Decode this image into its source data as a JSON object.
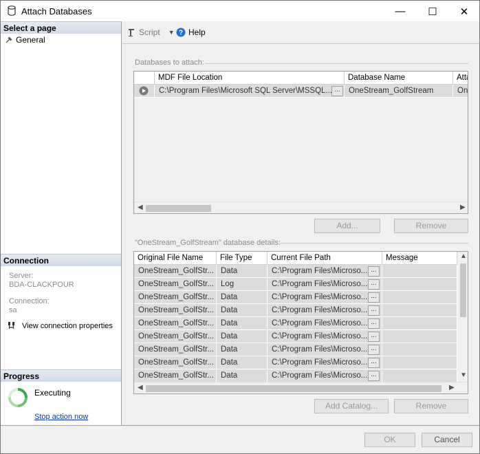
{
  "window": {
    "title": "Attach Databases",
    "minimize_glyph": "—",
    "maximize_glyph": "☐",
    "close_glyph": "✕"
  },
  "left": {
    "select_page_header": "Select a page",
    "general_label": "General",
    "connection_header": "Connection",
    "server_label": "Server:",
    "server_value": "BDA-CLACKPOUR",
    "connection_label": "Connection:",
    "connection_value": "sa",
    "view_props_label": "View connection properties",
    "progress_header": "Progress",
    "progress_status": "Executing",
    "stop_link": "Stop action now"
  },
  "toolbar": {
    "script_label": "Script",
    "help_label": "Help"
  },
  "attach": {
    "group_label": "Databases to attach:",
    "columns": [
      "MDF File Location",
      "Database Name",
      "Atta"
    ],
    "rows": [
      {
        "mdf": "C:\\Program Files\\Microsoft SQL Server\\MSSQL...",
        "dbname": "OneStream_GolfStream",
        "attach_as": "One"
      }
    ],
    "add_button": "Add...",
    "remove_button": "Remove"
  },
  "details": {
    "group_label": "\"OneStream_GolfStream\" database details:",
    "columns": [
      "Original File Name",
      "File Type",
      "Current File Path",
      "Message"
    ],
    "rows": [
      {
        "name": "OneStream_GolfStr...",
        "type": "Data",
        "path": "C:\\Program Files\\Microso...",
        "message": ""
      },
      {
        "name": "OneStream_GolfStr...",
        "type": "Log",
        "path": "C:\\Program Files\\Microso...",
        "message": ""
      },
      {
        "name": "OneStream_GolfStr...",
        "type": "Data",
        "path": "C:\\Program Files\\Microso...",
        "message": ""
      },
      {
        "name": "OneStream_GolfStr...",
        "type": "Data",
        "path": "C:\\Program Files\\Microso...",
        "message": ""
      },
      {
        "name": "OneStream_GolfStr...",
        "type": "Data",
        "path": "C:\\Program Files\\Microso...",
        "message": ""
      },
      {
        "name": "OneStream_GolfStr...",
        "type": "Data",
        "path": "C:\\Program Files\\Microso...",
        "message": ""
      },
      {
        "name": "OneStream_GolfStr...",
        "type": "Data",
        "path": "C:\\Program Files\\Microso...",
        "message": ""
      },
      {
        "name": "OneStream_GolfStr...",
        "type": "Data",
        "path": "C:\\Program Files\\Microso...",
        "message": ""
      },
      {
        "name": "OneStream_GolfStr...",
        "type": "Data",
        "path": "C:\\Program Files\\Microso...",
        "message": ""
      }
    ],
    "browse_glyph": "...",
    "add_catalog_button": "Add Catalog...",
    "remove_button": "Remove"
  },
  "footer": {
    "ok_button": "OK",
    "cancel_button": "Cancel"
  },
  "colors": {
    "section_header": "#cfd9e6",
    "link": "#0033cc",
    "disabled_text": "#9a9a9a",
    "progress_green": "#3aa64a"
  }
}
